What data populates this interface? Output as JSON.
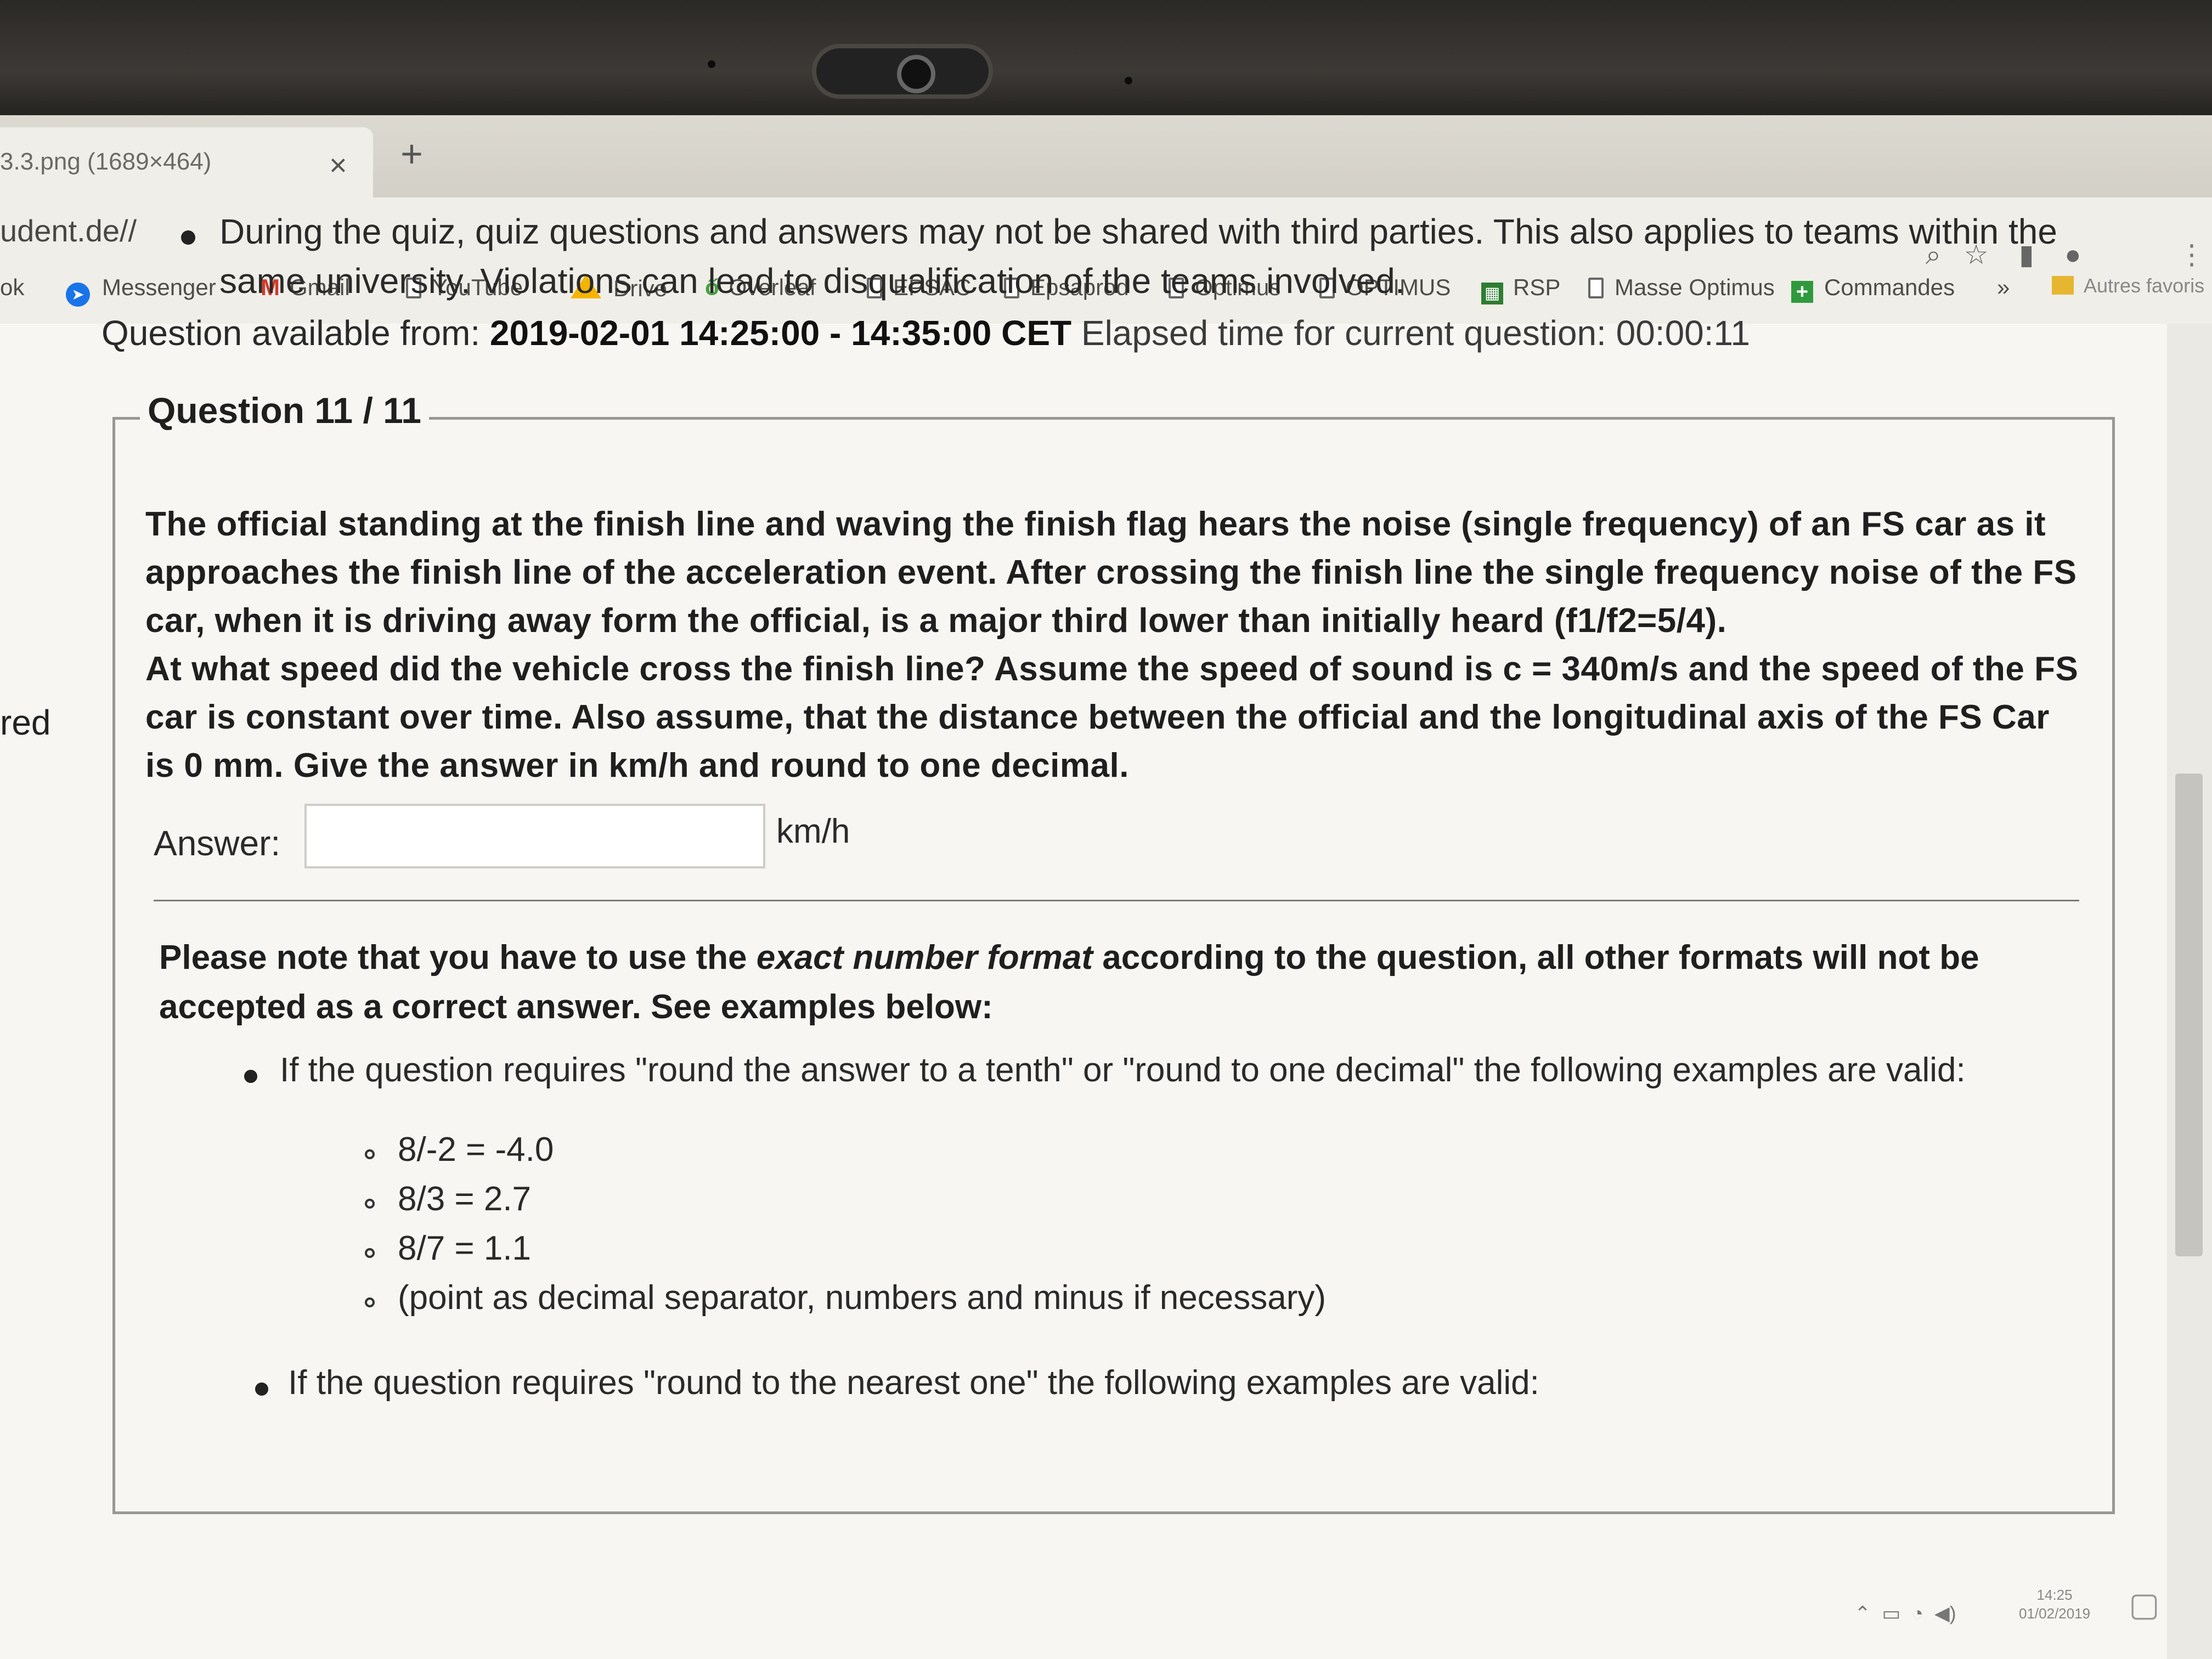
{
  "browser": {
    "tab_title": "3.3.png (1689×464)",
    "tab_close": "×",
    "new_tab": "+",
    "url": "udent.de//",
    "bookmarks": [
      {
        "label": "ok",
        "icon": "none"
      },
      {
        "label": "Messenger",
        "icon": "messenger-icon"
      },
      {
        "label": "Gmail",
        "icon": "gmail-icon"
      },
      {
        "label": "YouTube",
        "icon": "page-icon"
      },
      {
        "label": "Drive",
        "icon": "drive-icon"
      },
      {
        "label": "Overleaf",
        "icon": "overleaf-icon"
      },
      {
        "label": "EPSAC",
        "icon": "page-icon"
      },
      {
        "label": "Epsaprod",
        "icon": "page-icon"
      },
      {
        "label": "Optimus",
        "icon": "page-icon"
      },
      {
        "label": "OPTIMUS",
        "icon": "page-icon"
      },
      {
        "label": "RSP",
        "icon": "sheet-icon"
      },
      {
        "label": "Masse Optimus",
        "icon": "page-icon"
      },
      {
        "label": "Commandes",
        "icon": "plus-icon"
      },
      {
        "label": "»",
        "icon": "none"
      },
      {
        "label": "Autres favoris",
        "icon": "folder-icon"
      }
    ]
  },
  "page": {
    "left_sidebar_fragment": "red",
    "rules_line1": "During the quiz, quiz questions and answers may not be shared with third parties. This also applies to teams within the",
    "rules_line2": "same university. Violations can lead to disqualification of the teams involved.",
    "availability_prefix": "Question available from: ",
    "availability_window": "2019-02-01 14:25:00 - 14:35:00 CET",
    "elapsed_label": "Elapsed time for current question: 00:00:11",
    "question_legend": "Question 11 / 11",
    "question_lines": [
      "The official standing at the finish line and waving the finish flag hears the noise (single frequency) of an FS car as it",
      "approaches the finish line of the acceleration event. After crossing the finish line the single frequency noise of the FS",
      "car, when it is driving away form the official, is a major third lower than initially heard (f1/f2=5/4).",
      "At what speed did the vehicle cross the finish line? Assume the speed of sound is c = 340m/s and the speed of the FS",
      "car is constant over time. Also assume, that the distance between the official and the longitudinal axis of the FS Car",
      "is 0 mm. Give the answer in km/h and round to one decimal."
    ],
    "answer_label": "Answer:",
    "answer_value": "",
    "answer_unit": "km/h",
    "note_line1_a": "Please note that you have to use the ",
    "note_line1_em": "exact number format",
    "note_line1_b": " according to the question, all other formats will not be",
    "note_line2": "accepted as a correct answer. See examples below:",
    "rule_tenth": "If the question requires \"round the answer to a tenth\" or \"round to one decimal\" the following examples are valid:",
    "examples_tenth": [
      "8/-2 = -4.0",
      "8/3 = 2.7",
      "8/7 = 1.1",
      "(point as decimal separator, numbers and minus if necessary)"
    ],
    "rule_one": "If the question requires \"round to the nearest one\" the following examples are valid:"
  },
  "taskbar": {
    "clock_time": "14:25",
    "clock_date": "01/02/2019"
  }
}
